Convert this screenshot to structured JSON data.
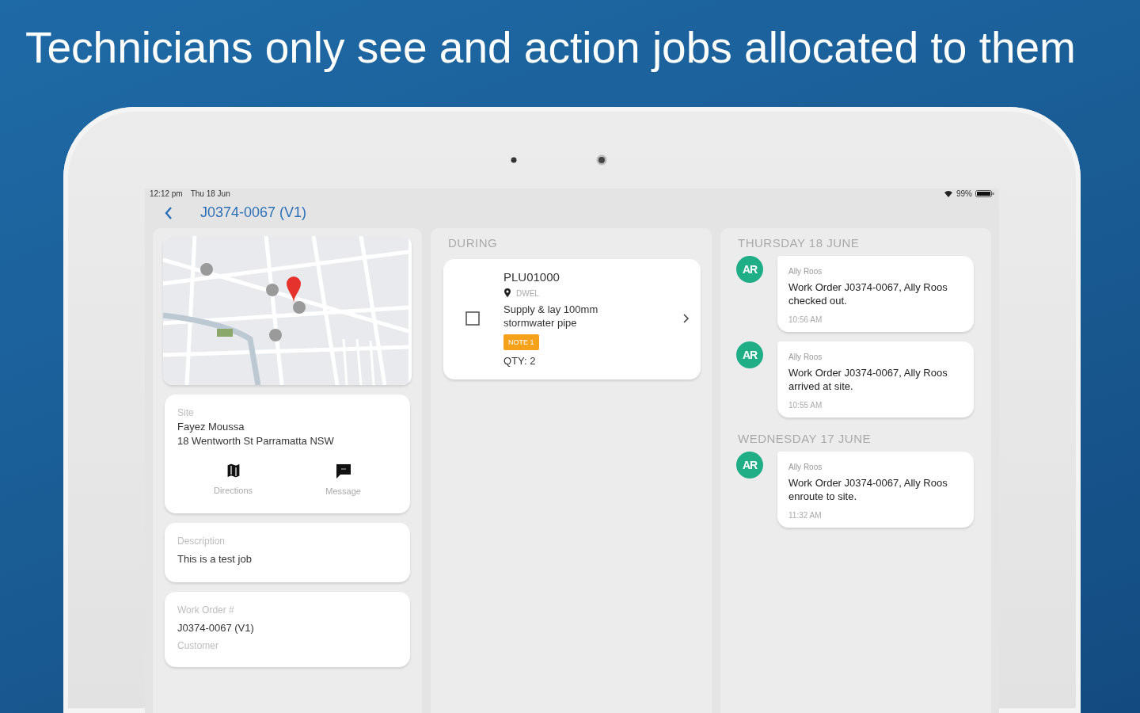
{
  "headline": "Technicians only see and action jobs allocated to them",
  "status_bar": {
    "time": "12:12 pm",
    "date": "Thu 18 Jun",
    "battery": "99%"
  },
  "header": {
    "title": "J0374-0067 (V1)"
  },
  "site": {
    "label": "Site",
    "name": "Fayez Moussa",
    "address": "18 Wentworth St Parramatta NSW",
    "actions": [
      {
        "label": "Directions",
        "kind": "map"
      },
      {
        "label": "Message",
        "kind": "message"
      }
    ]
  },
  "description": {
    "label": "Description",
    "text": "This is a test job"
  },
  "work_order": {
    "label": "Work Order #",
    "value": "J0374-0067 (V1)",
    "customer_label": "Customer"
  },
  "items_section": {
    "title": "DURING",
    "items": [
      {
        "code": "PLU01000",
        "location": "DWEL",
        "description": "Supply & lay 100mm stormwater pipe",
        "badge": "NOTE 1",
        "quantity": "QTY: 2",
        "checked": false
      }
    ]
  },
  "activity": [
    {
      "date": "THURSDAY 18 JUNE",
      "entries": [
        {
          "initials": "AR",
          "author": "Ally Roos",
          "message": "Work Order J0374-0067, Ally Roos checked out.",
          "time": "10:56 AM"
        },
        {
          "initials": "AR",
          "author": "Ally Roos",
          "message": "Work Order J0374-0067, Ally Roos arrived at site.",
          "time": "10:55 AM"
        }
      ]
    },
    {
      "date": "WEDNESDAY 17 JUNE",
      "entries": [
        {
          "initials": "AR",
          "author": "Ally Roos",
          "message": "Work Order J0374-0067, Ally Roos enroute to site.",
          "time": "11:32 AM"
        }
      ]
    }
  ]
}
